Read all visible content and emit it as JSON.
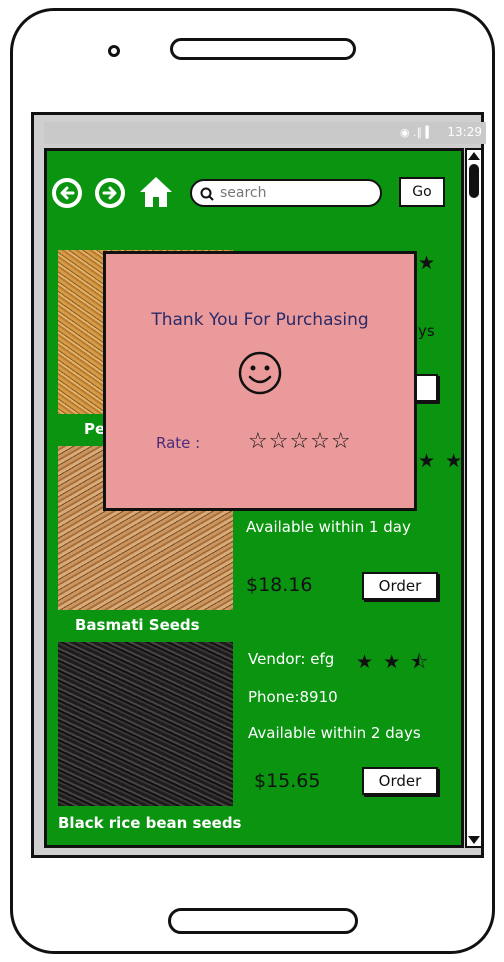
{
  "status_bar": {
    "time": "13:29",
    "icons": "◉ .∥ ▍"
  },
  "toolbar": {
    "back_icon": "back-arrow-icon",
    "forward_icon": "forward-arrow-icon",
    "home_icon": "home-icon",
    "search_placeholder": "search",
    "go_label": "Go"
  },
  "products": [
    {
      "name": "Pe",
      "vendor_stars": "★",
      "availability_partial": "ys",
      "order_label": ""
    },
    {
      "name": "Basmati Seeds",
      "vendor_stars": "★ ★",
      "availability": "Available within 1 day",
      "price": "$18.16",
      "order_label": "Order"
    },
    {
      "name": "Black rice bean seeds",
      "vendor": "Vendor: efg",
      "vendor_stars": "★ ★ ⯪",
      "phone": "Phone:8910",
      "availability": "Available within 2 days",
      "price": "$15.65",
      "order_label": "Order"
    }
  ],
  "modal": {
    "title": "Thank You For Purchasing",
    "smiley_icon": "smiley-face-icon",
    "rate_label": "Rate :",
    "rate_stars": "☆☆☆☆☆"
  },
  "colors": {
    "app_background": "#0a9410",
    "modal_background": "#ea9a9a",
    "frame": "#111111"
  }
}
